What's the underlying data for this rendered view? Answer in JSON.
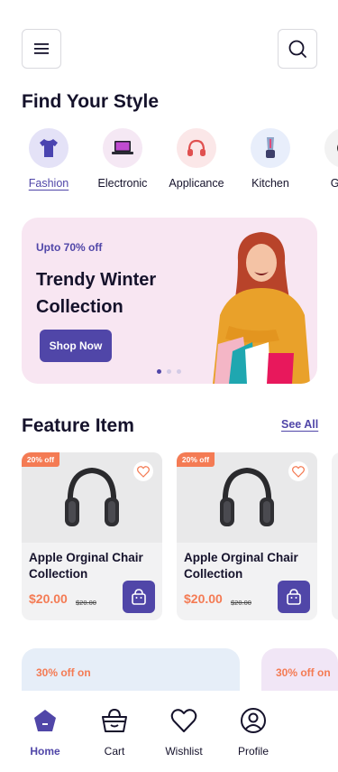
{
  "header": {
    "menu_icon": "hamburger-icon",
    "search_icon": "search-icon"
  },
  "categories_section": {
    "title": "Find Your Style",
    "items": [
      {
        "label": "Fashion",
        "icon": "tshirt-icon",
        "active": true
      },
      {
        "label": "Electronic",
        "icon": "laptop-icon",
        "active": false
      },
      {
        "label": "Applicance",
        "icon": "headset-icon",
        "active": false
      },
      {
        "label": "Kitchen",
        "icon": "blender-icon",
        "active": false
      },
      {
        "label": "Gadg",
        "icon": "gadget-icon",
        "active": false
      }
    ]
  },
  "banner": {
    "subtitle": "Upto 70% off",
    "title": "Trendy Winter Collection",
    "button": "Shop Now",
    "slides": 3,
    "active_slide": 1
  },
  "featured": {
    "title": "Feature Item",
    "see_all": "See All",
    "products": [
      {
        "name": "Apple Orginal Chair Collection",
        "price": "$20.00",
        "old_price": "$20.00",
        "discount": "20% off"
      },
      {
        "name": "Apple Orginal Chair Collection",
        "price": "$20.00",
        "old_price": "$20.00",
        "discount": "20% off"
      }
    ]
  },
  "promos": [
    {
      "text": "30% off on"
    },
    {
      "text": "30% off on"
    }
  ],
  "bottom_nav": [
    {
      "label": "Home",
      "icon": "home-icon",
      "active": true
    },
    {
      "label": "Cart",
      "icon": "cart-icon",
      "active": false
    },
    {
      "label": "Wishlist",
      "icon": "heart-icon",
      "active": false
    },
    {
      "label": "Profile",
      "icon": "profile-icon",
      "active": false
    }
  ],
  "colors": {
    "accent": "#5046a8",
    "discount": "#f47b54",
    "banner_bg": "#f8e6f2"
  }
}
